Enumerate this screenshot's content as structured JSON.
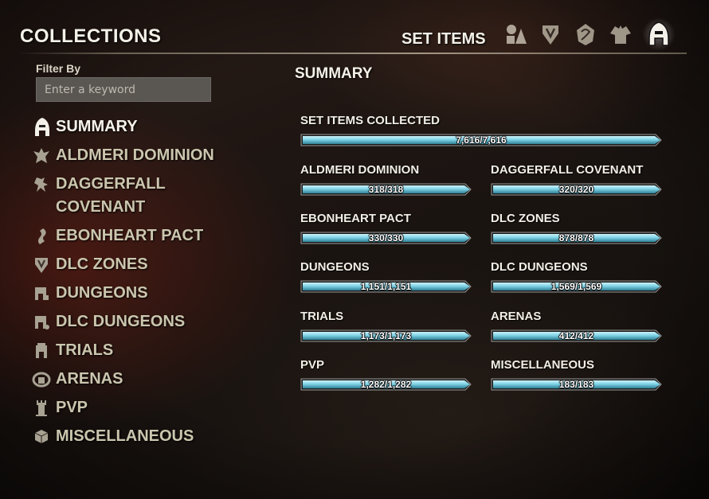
{
  "header": {
    "title": "COLLECTIONS",
    "category_title": "SET ITEMS"
  },
  "category_icons": [
    "shapes-icon",
    "crest-icon",
    "dragon-icon",
    "armor-icon",
    "set-helm-icon"
  ],
  "filter": {
    "label": "Filter By",
    "placeholder": "Enter a keyword",
    "value": ""
  },
  "nav": {
    "items": [
      {
        "label": "SUMMARY",
        "icon": "set-helm-icon",
        "active": true
      },
      {
        "label": "ALDMERI DOMINION",
        "icon": "eagle-icon"
      },
      {
        "label": "DAGGERFALL COVENANT",
        "icon": "lion-icon"
      },
      {
        "label": "EBONHEART PACT",
        "icon": "dragon-icon"
      },
      {
        "label": "DLC ZONES",
        "icon": "crest-icon"
      },
      {
        "label": "DUNGEONS",
        "icon": "door-icon"
      },
      {
        "label": "DLC DUNGEONS",
        "icon": "door-icon"
      },
      {
        "label": "TRIALS",
        "icon": "door-icon"
      },
      {
        "label": "ARENAS",
        "icon": "arena-icon"
      },
      {
        "label": "PVP",
        "icon": "tower-icon"
      },
      {
        "label": "MISCELLANEOUS",
        "icon": "dice-icon"
      }
    ]
  },
  "summary": {
    "heading": "SUMMARY",
    "total": {
      "label": "SET ITEMS COLLECTED",
      "value": "7,616/7,616",
      "fraction": 1.0
    },
    "stats": [
      {
        "label": "ALDMERI DOMINION",
        "value": "318/318",
        "fraction": 1.0
      },
      {
        "label": "DAGGERFALL COVENANT",
        "value": "320/320",
        "fraction": 1.0
      },
      {
        "label": "EBONHEART PACT",
        "value": "330/330",
        "fraction": 1.0
      },
      {
        "label": "DLC ZONES",
        "value": "878/878",
        "fraction": 1.0
      },
      {
        "label": "DUNGEONS",
        "value": "1,151/1,151",
        "fraction": 1.0
      },
      {
        "label": "DLC DUNGEONS",
        "value": "1,569/1,569",
        "fraction": 1.0
      },
      {
        "label": "TRIALS",
        "value": "1,173/1,173",
        "fraction": 1.0
      },
      {
        "label": "ARENAS",
        "value": "412/412",
        "fraction": 1.0
      },
      {
        "label": "PVP",
        "value": "1,282/1,282",
        "fraction": 1.0
      },
      {
        "label": "MISCELLANEOUS",
        "value": "183/183",
        "fraction": 1.0
      }
    ]
  },
  "colors": {
    "bar_fill": "#7fd3e6",
    "bar_fill_dark": "#2e7f95",
    "text": "#f2efe6",
    "nav_inactive": "#cbc6ae"
  }
}
